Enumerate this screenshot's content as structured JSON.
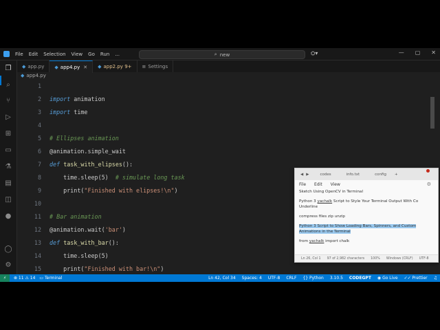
{
  "titlebar": {
    "menu": [
      "File",
      "Edit",
      "Selection",
      "View",
      "Go",
      "Run",
      "..."
    ],
    "search": "new",
    "copilot_icon": "copilot-icon"
  },
  "tabs": [
    {
      "label": "app.py",
      "modified": ""
    },
    {
      "label": "app4.py",
      "modified": ""
    },
    {
      "label": "app2.py",
      "modified": "9+"
    },
    {
      "label": "Settings",
      "modified": ""
    }
  ],
  "breadcrumb": "app4.py",
  "editor": {
    "line_numbers": [
      "1",
      "2",
      "3",
      "4",
      "5",
      "6",
      "7",
      "8",
      "9",
      "10",
      "11",
      "12",
      "13",
      "14",
      "15"
    ]
  },
  "statusbar": {
    "problems": "⊗ 11 ⚠ 14",
    "terminal": "Terminal",
    "position": "Ln 42, Col 34",
    "spaces": "Spaces: 4",
    "encoding": "UTF-8",
    "eol": "CRLF",
    "language": "Python",
    "version": "3.10.5",
    "brand": "CODEGPT",
    "golive": "Go Live",
    "prettier": "Prettier"
  },
  "notepad": {
    "tabs": [
      "codes",
      "info.txt",
      "config"
    ],
    "menu": [
      "File",
      "Edit",
      "View"
    ],
    "status": [
      "Ln 26, Col 1",
      "97 of 2,982 characters",
      "100%",
      "Windows (CRLF)",
      "UTF-8"
    ]
  }
}
